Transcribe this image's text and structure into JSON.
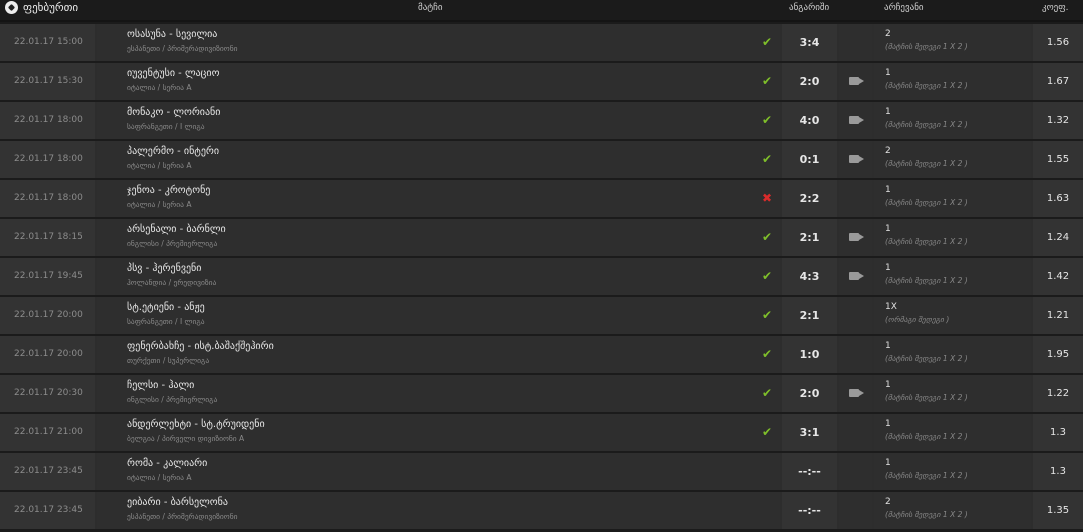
{
  "header": {
    "sport": "ფეხბურთი",
    "event": "მატჩი",
    "score": "ანგარიში",
    "pick": "არჩევანი",
    "odd": "კოეფ."
  },
  "rows": [
    {
      "date": "22.01.17 15:00",
      "title": "ოსასუნა - სევილია",
      "sub": "ესპანეთი / პრიმერადივიზიონი",
      "status": "ok",
      "score": "3:4",
      "tv": false,
      "pick": "2",
      "pick_market": "(მატჩის შედეგი 1 X 2 )",
      "odd": "1.56"
    },
    {
      "date": "22.01.17 15:30",
      "title": "იუვენტუსი - ლაციო",
      "sub": "იტალია / სერია A",
      "status": "ok",
      "score": "2:0",
      "tv": true,
      "pick": "1",
      "pick_market": "(მატჩის შედეგი 1 X 2 )",
      "odd": "1.67"
    },
    {
      "date": "22.01.17 18:00",
      "title": "მონაკო - ლორიანი",
      "sub": "საფრანგეთი / I ლიგა",
      "status": "ok",
      "score": "4:0",
      "tv": true,
      "pick": "1",
      "pick_market": "(მატჩის შედეგი 1 X 2 )",
      "odd": "1.32"
    },
    {
      "date": "22.01.17 18:00",
      "title": "პალერმო - ინტერი",
      "sub": "იტალია / სერია A",
      "status": "ok",
      "score": "0:1",
      "tv": true,
      "pick": "2",
      "pick_market": "(მატჩის შედეგი 1 X 2 )",
      "odd": "1.55"
    },
    {
      "date": "22.01.17 18:00",
      "title": "ჯენოა - კროტონე",
      "sub": "იტალია / სერია A",
      "status": "bad",
      "score": "2:2",
      "tv": false,
      "pick": "1",
      "pick_market": "(მატჩის შედეგი 1 X 2 )",
      "odd": "1.63"
    },
    {
      "date": "22.01.17 18:15",
      "title": "არსენალი - ბარნლი",
      "sub": "ინგლისი / პრემიერლიგა",
      "status": "ok",
      "score": "2:1",
      "tv": true,
      "pick": "1",
      "pick_market": "(მატჩის შედეგი 1 X 2 )",
      "odd": "1.24"
    },
    {
      "date": "22.01.17 19:45",
      "title": "პსვ - ჰერენვენი",
      "sub": "ჰოლანდია / ერედივიზია",
      "status": "ok",
      "score": "4:3",
      "tv": true,
      "pick": "1",
      "pick_market": "(მატჩის შედეგი 1 X 2 )",
      "odd": "1.42"
    },
    {
      "date": "22.01.17 20:00",
      "title": "სტ.ეტიენი - ანჟე",
      "sub": "საფრანგეთი / I ლიგა",
      "status": "ok",
      "score": "2:1",
      "tv": false,
      "pick": "1X",
      "pick_market": "(ორმაგი შედეგი )",
      "odd": "1.21"
    },
    {
      "date": "22.01.17 20:00",
      "title": "ფენერბახჩე - ისტ.ბაშაქშეჰირი",
      "sub": "თურქეთი / სუპერლიგა",
      "status": "ok",
      "score": "1:0",
      "tv": false,
      "pick": "1",
      "pick_market": "(მატჩის შედეგი 1 X 2 )",
      "odd": "1.95"
    },
    {
      "date": "22.01.17 20:30",
      "title": "ჩელსი - ჰალი",
      "sub": "ინგლისი / პრემიერლიგა",
      "status": "ok",
      "score": "2:0",
      "tv": true,
      "pick": "1",
      "pick_market": "(მატჩის შედეგი 1 X 2 )",
      "odd": "1.22"
    },
    {
      "date": "22.01.17 21:00",
      "title": "ანდერლეხტი - სტ.ტრუიდენი",
      "sub": "ბელგია / პირველი დივიზიონი A",
      "status": "ok",
      "score": "3:1",
      "tv": false,
      "pick": "1",
      "pick_market": "(მატჩის შედეგი 1 X 2 )",
      "odd": "1.3"
    },
    {
      "date": "22.01.17 23:45",
      "title": "რომა - კალიარი",
      "sub": "იტალია / სერია A",
      "status": "none",
      "score": "--:--",
      "tv": false,
      "pick": "1",
      "pick_market": "(მატჩის შედეგი 1 X 2 )",
      "odd": "1.3"
    },
    {
      "date": "22.01.17 23:45",
      "title": "ეიბარი - ბარსელონა",
      "sub": "ესპანეთი / პრიმერადივიზიონი",
      "status": "none",
      "score": "--:--",
      "tv": false,
      "pick": "2",
      "pick_market": "(მატჩის შედეგი 1 X 2 )",
      "odd": "1.35"
    }
  ],
  "icons": {
    "ok": "check-icon",
    "bad": "cross-icon",
    "tv": "video-camera-icon",
    "sport": "soccer-ball-icon"
  },
  "colors": {
    "ok": "#7fbf2a",
    "bad": "#d92b2b"
  }
}
